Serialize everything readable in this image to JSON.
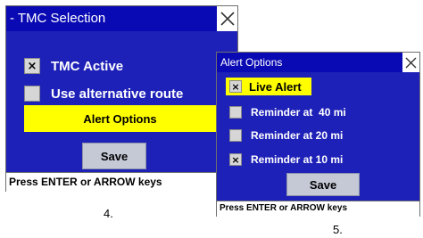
{
  "colors": {
    "title_bar": "#0a0ab4",
    "panel": "#1e21b8",
    "highlight": "#ffff00",
    "button": "#c5c9d6"
  },
  "screen4": {
    "title": "- TMC Selection",
    "options": [
      {
        "label": "TMC Active",
        "checked": true,
        "mark": "×"
      },
      {
        "label": "Use alternative route",
        "checked": false,
        "mark": ""
      }
    ],
    "alert_options_label": "Alert Options",
    "save_label": "Save",
    "status_text": "Press ENTER or ARROW keys",
    "caption": "4."
  },
  "screen5": {
    "title": "Alert Options",
    "options": [
      {
        "label": "Live Alert",
        "checked": true,
        "mark": "×",
        "highlighted": true
      },
      {
        "label": "Reminder at  40 mi",
        "checked": false,
        "mark": ""
      },
      {
        "label": "Reminder at 20 mi",
        "checked": false,
        "mark": ""
      },
      {
        "label": "Reminder at 10 mi",
        "checked": true,
        "mark": "×"
      }
    ],
    "save_label": "Save",
    "status_text": "Press ENTER or ARROW keys",
    "caption": "5."
  }
}
